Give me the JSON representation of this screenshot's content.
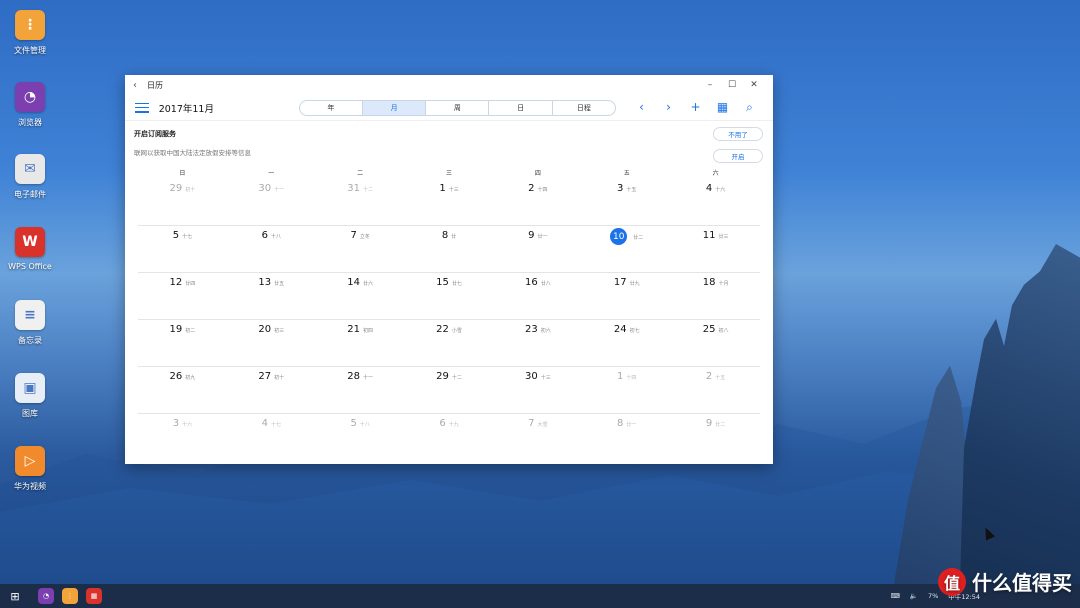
{
  "desktop": {
    "icons": [
      {
        "label": "文件管理",
        "color": "#f2a33a",
        "glyph": "⋮"
      },
      {
        "label": "浏览器",
        "color": "#7b3fb0",
        "glyph": "◔"
      },
      {
        "label": "电子邮件",
        "color": "#e8e8e8",
        "glyph": "✉"
      },
      {
        "label": "WPS Office",
        "color": "#d9322b",
        "glyph": "W"
      },
      {
        "label": "备忘录",
        "color": "#f0f0f0",
        "glyph": "≡"
      },
      {
        "label": "图库",
        "color": "#e8eef6",
        "glyph": "▣"
      },
      {
        "label": "华为视频",
        "color": "#f08a2c",
        "glyph": "▷"
      }
    ]
  },
  "window": {
    "title": "日历",
    "month_title": "2017年11月",
    "tabs": [
      {
        "label": "年",
        "active": false
      },
      {
        "label": "月",
        "active": true
      },
      {
        "label": "周",
        "active": false
      },
      {
        "label": "日",
        "active": false
      },
      {
        "label": "日程",
        "active": false
      }
    ],
    "subscribe": {
      "title": "开启订阅服务",
      "desc": "联网以获取中国大陆法定放假安排等信息",
      "dismiss_label": "不用了",
      "enable_label": "开启"
    },
    "weekdays": [
      "日",
      "一",
      "二",
      "三",
      "四",
      "五",
      "六"
    ],
    "weeks": [
      [
        {
          "n": "29",
          "l": "初十",
          "o": true
        },
        {
          "n": "30",
          "l": "十一",
          "o": true
        },
        {
          "n": "31",
          "l": "十二",
          "o": true
        },
        {
          "n": "1",
          "l": "十三"
        },
        {
          "n": "2",
          "l": "十四"
        },
        {
          "n": "3",
          "l": "十五"
        },
        {
          "n": "4",
          "l": "十六"
        }
      ],
      [
        {
          "n": "5",
          "l": "十七"
        },
        {
          "n": "6",
          "l": "十八"
        },
        {
          "n": "7",
          "l": "立冬"
        },
        {
          "n": "8",
          "l": "廿"
        },
        {
          "n": "9",
          "l": "廿一"
        },
        {
          "n": "10",
          "l": "廿二",
          "t": true
        },
        {
          "n": "11",
          "l": "廿三"
        }
      ],
      [
        {
          "n": "12",
          "l": "廿四"
        },
        {
          "n": "13",
          "l": "廿五"
        },
        {
          "n": "14",
          "l": "廿六"
        },
        {
          "n": "15",
          "l": "廿七"
        },
        {
          "n": "16",
          "l": "廿八"
        },
        {
          "n": "17",
          "l": "廿九"
        },
        {
          "n": "18",
          "l": "十月"
        }
      ],
      [
        {
          "n": "19",
          "l": "初二"
        },
        {
          "n": "20",
          "l": "初三"
        },
        {
          "n": "21",
          "l": "初四"
        },
        {
          "n": "22",
          "l": "小雪"
        },
        {
          "n": "23",
          "l": "初六"
        },
        {
          "n": "24",
          "l": "初七"
        },
        {
          "n": "25",
          "l": "初八"
        }
      ],
      [
        {
          "n": "26",
          "l": "初九"
        },
        {
          "n": "27",
          "l": "初十"
        },
        {
          "n": "28",
          "l": "十一"
        },
        {
          "n": "29",
          "l": "十二"
        },
        {
          "n": "30",
          "l": "十三"
        },
        {
          "n": "1",
          "l": "十四",
          "o": true
        },
        {
          "n": "2",
          "l": "十五",
          "o": true
        }
      ],
      [
        {
          "n": "3",
          "l": "十六",
          "o": true
        },
        {
          "n": "4",
          "l": "十七",
          "o": true
        },
        {
          "n": "5",
          "l": "十八",
          "o": true
        },
        {
          "n": "6",
          "l": "十九",
          "o": true
        },
        {
          "n": "7",
          "l": "大雪",
          "o": true
        },
        {
          "n": "8",
          "l": "廿一",
          "o": true
        },
        {
          "n": "9",
          "l": "廿二",
          "o": true
        }
      ]
    ]
  },
  "taskbar": {
    "battery": "7%",
    "clock": "中午12:54"
  },
  "watermark": {
    "badge": "值",
    "text": "什么值得买"
  },
  "colors": {
    "accent": "#1a73e8"
  }
}
